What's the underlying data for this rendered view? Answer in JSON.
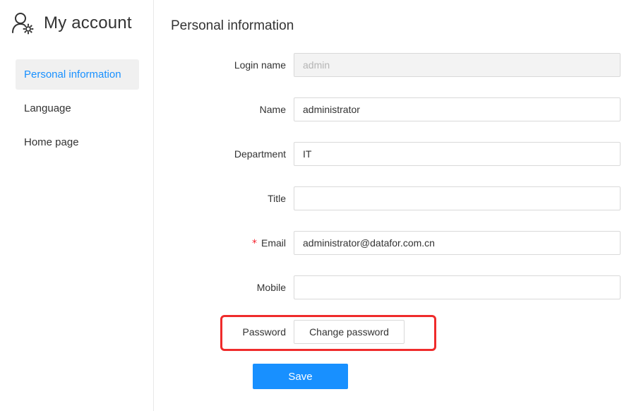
{
  "sidebar": {
    "title": "My account",
    "icon": "user-settings-icon",
    "items": [
      {
        "label": "Personal information",
        "active": true
      },
      {
        "label": "Language",
        "active": false
      },
      {
        "label": "Home page",
        "active": false
      }
    ]
  },
  "main": {
    "section_title": "Personal information",
    "fields": {
      "login_name": {
        "label": "Login name",
        "value": "admin",
        "disabled": true
      },
      "name": {
        "label": "Name",
        "value": "administrator"
      },
      "department": {
        "label": "Department",
        "value": "IT"
      },
      "title": {
        "label": "Title",
        "value": ""
      },
      "email": {
        "label": "Email",
        "value": "administrator@datafor.com.cn",
        "required_mark": "*"
      },
      "mobile": {
        "label": "Mobile",
        "value": ""
      },
      "password": {
        "label": "Password",
        "button_label": "Change password"
      }
    },
    "save_label": "Save"
  },
  "colors": {
    "accent": "#1890ff",
    "highlight": "#ef2b2b",
    "required": "#f5222d"
  }
}
